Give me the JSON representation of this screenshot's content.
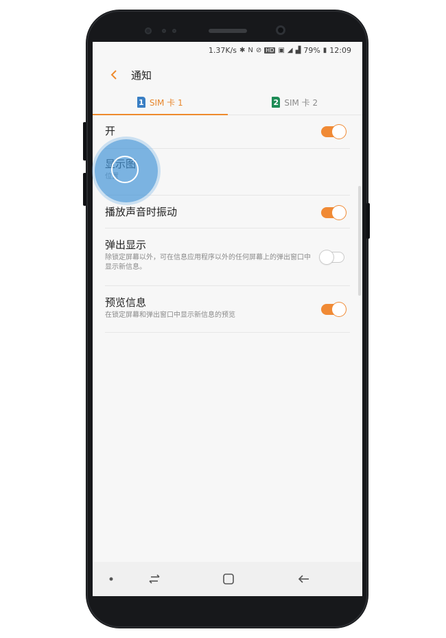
{
  "status_bar": {
    "speed": "1.37K/s",
    "battery": "79%",
    "time": "12:09",
    "icons": [
      "bluetooth-icon",
      "nfc-icon",
      "hd-icon",
      "vibrate-icon",
      "wifi-icon",
      "signal-icon",
      "battery-icon"
    ]
  },
  "appbar": {
    "title": "通知"
  },
  "tabs": [
    {
      "number": "1",
      "label": "SIM 卡 1",
      "active": true,
      "color": "#3a7fc4"
    },
    {
      "number": "2",
      "label": "SIM 卡 2",
      "active": false,
      "color": "#1d8c56"
    }
  ],
  "settings": {
    "on": {
      "title": "开",
      "enabled": true
    },
    "display": {
      "title": "显示图",
      "subtitle": "位置"
    },
    "vibrate": {
      "title": "播放声音时振动",
      "enabled": true
    },
    "popup": {
      "title": "弹出显示",
      "subtitle": "除锁定屏幕以外，可在信息应用程序以外的任何屏幕上的弹出窗口中显示新信息。",
      "enabled": false
    },
    "preview": {
      "title": "预览信息",
      "subtitle": "在锁定屏幕和弹出窗口中显示新信息的预览",
      "enabled": true
    }
  },
  "colors": {
    "accent": "#ee8a2c",
    "toggle_on": "#f08a35",
    "touch_indicator": "#4092d6"
  }
}
